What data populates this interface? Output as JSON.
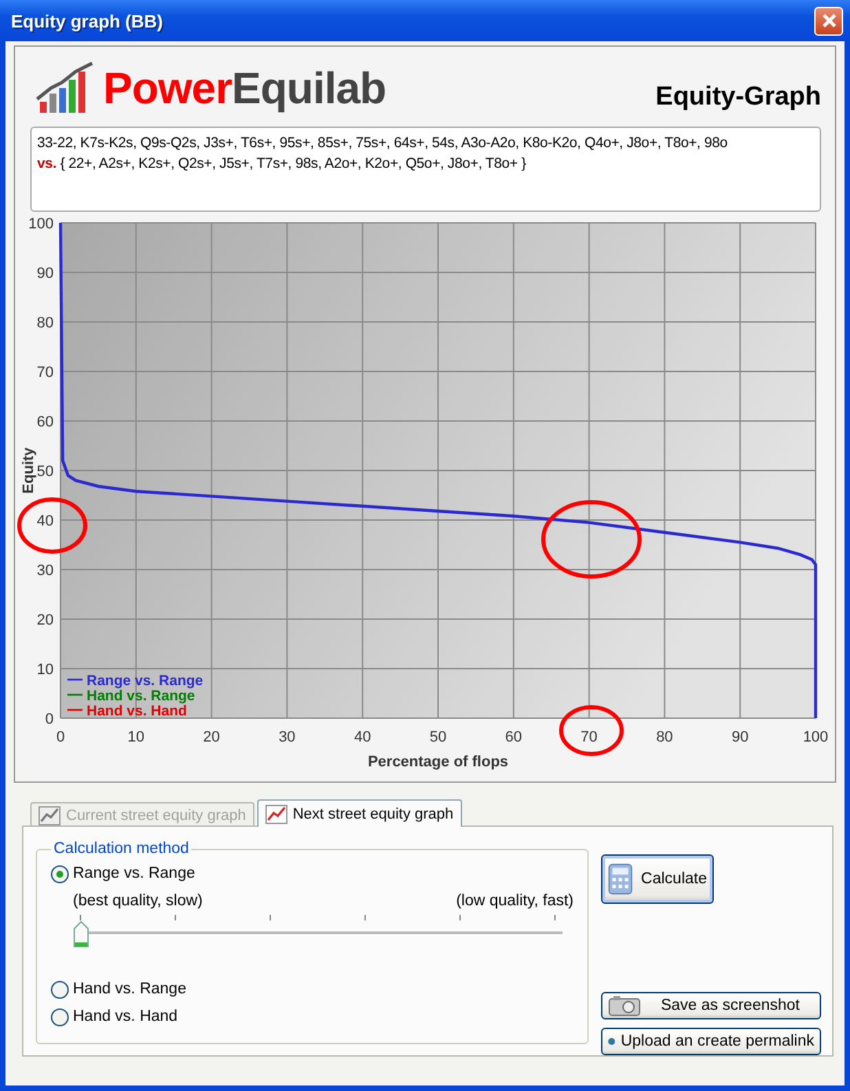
{
  "window": {
    "title": "Equity graph (BB)"
  },
  "logo": {
    "part_1": "Power",
    "part_2": "Equilab"
  },
  "heading": "Equity-Graph",
  "ranges": {
    "hero": "33-22, K7s-K2s, Q9s-Q2s, J3s+, T6s+, 95s+, 85s+, 75s+, 64s+, 54s, A3o-A2o, K8o-K2o, Q4o+, J8o+, T8o+, 98o",
    "separator": "vs.",
    "villain": "{ 22+, A2s+, K2s+, Q2s+, J5s+, T7s+, 98s, A2o+, K2o+, Q5o+, J8o+, T8o+ }"
  },
  "chart": {
    "chart_data": {
      "type": "line",
      "xlabel": "Percentage of flops",
      "ylabel": "Equity",
      "x": [
        0,
        0.3,
        1,
        2,
        5,
        10,
        20,
        30,
        40,
        50,
        60,
        70,
        80,
        90,
        95,
        98,
        99.5,
        100,
        100
      ],
      "xlim": [
        0,
        100
      ],
      "ylim": [
        0,
        100
      ],
      "xticks": [
        0,
        10,
        20,
        30,
        40,
        50,
        60,
        70,
        80,
        90,
        100
      ],
      "yticks": [
        0,
        10,
        20,
        30,
        40,
        50,
        60,
        70,
        80,
        90,
        100
      ],
      "grid": true,
      "series": [
        {
          "name": "Range vs. Range",
          "color": "#2a2ad0",
          "values": [
            100,
            52,
            49,
            48,
            46.8,
            45.8,
            44.8,
            43.8,
            42.8,
            41.8,
            40.8,
            39.5,
            37.5,
            35.5,
            34.3,
            33,
            32,
            31,
            0
          ]
        },
        {
          "name": "Hand vs. Range",
          "color": "#008000",
          "values": [
            null,
            null,
            null,
            null,
            null,
            null,
            null,
            null,
            null,
            null,
            null,
            null,
            null,
            null,
            null,
            null,
            null,
            null,
            null
          ]
        },
        {
          "name": "Hand vs. Hand",
          "color": "#e00000",
          "values": [
            null,
            null,
            null,
            null,
            null,
            null,
            null,
            null,
            null,
            null,
            null,
            null,
            null,
            null,
            null,
            null,
            null,
            null,
            null
          ]
        }
      ]
    }
  },
  "tabs": [
    {
      "label": "Current street equity graph",
      "selected": false,
      "disabled": true
    },
    {
      "label": "Next street equity graph",
      "selected": true,
      "disabled": false
    }
  ],
  "group_title": "Calculation method",
  "methods": [
    {
      "label": "Range vs. Range",
      "selected": true
    },
    {
      "label": "Hand vs. Range",
      "selected": false
    },
    {
      "label": "Hand vs. Hand",
      "selected": false
    }
  ],
  "quality_slider": {
    "left_label": "(best quality, slow)",
    "right_label": "(low quality, fast)",
    "level": 0
  },
  "buttons": {
    "calculate": "Calculate",
    "save": "Save as screenshot",
    "upload": "Upload an create permalink"
  }
}
